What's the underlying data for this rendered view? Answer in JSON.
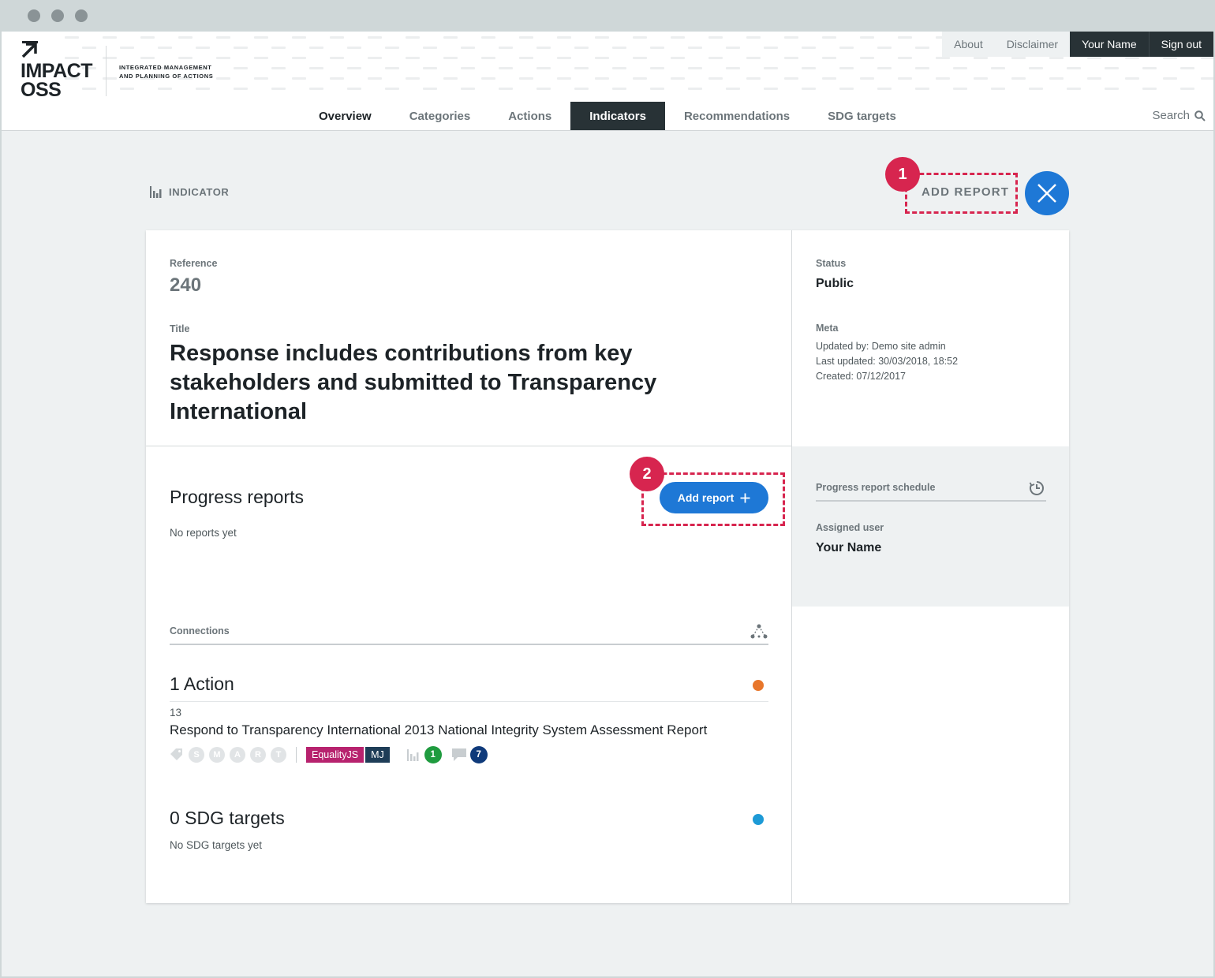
{
  "browser": {
    "dots": 3
  },
  "logo": {
    "line1": "IMPACT",
    "line2": "OSS",
    "sub1": "INTEGRATED MANAGEMENT",
    "sub2": "AND PLANNING OF ACTIONS"
  },
  "topnav": {
    "about": "About",
    "disclaimer": "Disclaimer",
    "user": "Your Name",
    "signout": "Sign out"
  },
  "mainnav": {
    "tabs": [
      {
        "label": "Overview"
      },
      {
        "label": "Categories"
      },
      {
        "label": "Actions"
      },
      {
        "label": "Indicators"
      },
      {
        "label": "Recommendations"
      },
      {
        "label": "SDG targets"
      }
    ],
    "active": "Indicators",
    "search": "Search"
  },
  "page": {
    "label": "INDICATOR",
    "add_report": "ADD REPORT",
    "step1": "1",
    "step2": "2"
  },
  "indicator": {
    "reference_label": "Reference",
    "reference": "240",
    "title_label": "Title",
    "title": "Response includes contributions from key stakeholders and submitted to Transparency International",
    "status_label": "Status",
    "status": "Public",
    "meta_label": "Meta",
    "updated_by": "Updated by: Demo site admin",
    "last_updated": "Last updated: 30/03/2018, 18:52",
    "created": "Created: 07/12/2017"
  },
  "progress": {
    "title": "Progress reports",
    "empty": "No reports yet",
    "add_button": "Add report",
    "schedule_label": "Progress report schedule",
    "assigned_label": "Assigned user",
    "assigned_user": "Your Name"
  },
  "connections": {
    "label": "Connections",
    "actions": {
      "title": "1 Action",
      "color": "#e8762b",
      "item": {
        "ref": "13",
        "title": "Respond to Transparency International 2013 National Integrity System Assessment Report",
        "smart": [
          "S",
          "M",
          "A",
          "R",
          "T"
        ],
        "tags": [
          {
            "label": "EqualityJS",
            "color": "#b7226e"
          },
          {
            "label": "MJ",
            "color": "#1e3d57"
          }
        ],
        "indicator_count": "1",
        "indicator_color": "#1f9b3f",
        "comment_count": "7",
        "comment_color": "#0f3a7a"
      }
    },
    "sdg": {
      "title": "0 SDG targets",
      "color": "#1d9ad6",
      "empty": "No SDG targets yet"
    }
  },
  "colors": {
    "accent": "#1e78d6",
    "highlight": "#d7254f",
    "dark": "#283236"
  }
}
